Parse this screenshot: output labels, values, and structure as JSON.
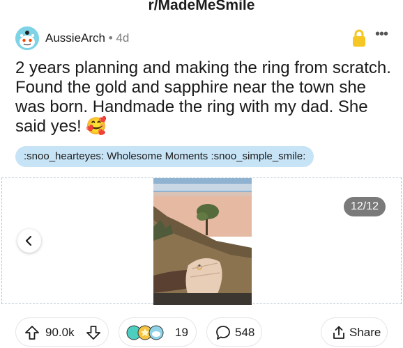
{
  "header": {
    "subreddit": "r/MadeMeSmile"
  },
  "post": {
    "author": "AussieArch",
    "separator": "•",
    "age": "4d",
    "more_label": "•••",
    "title": "2 years planning and making the ring from scratch. Found the gold and sapphire near the town she was born. Handmade the ring with my dad. She said yes! 🥰",
    "flair": ":snoo_hearteyes: Wholesome Moments :snoo_simple_smile:"
  },
  "gallery": {
    "counter": "12/12"
  },
  "actions": {
    "votes": "90.0k",
    "awards_count": "19",
    "comments": "548",
    "share_label": "Share"
  },
  "colors": {
    "flair_bg": "#c7e3f6",
    "lock": "#f6c624",
    "counter_bg": "#7a7a7a"
  },
  "icons": [
    "snoo-avatar-icon",
    "lock-icon",
    "more-icon",
    "chevron-left-icon",
    "upvote-icon",
    "downvote-icon",
    "award-icon",
    "comment-icon",
    "share-icon"
  ]
}
